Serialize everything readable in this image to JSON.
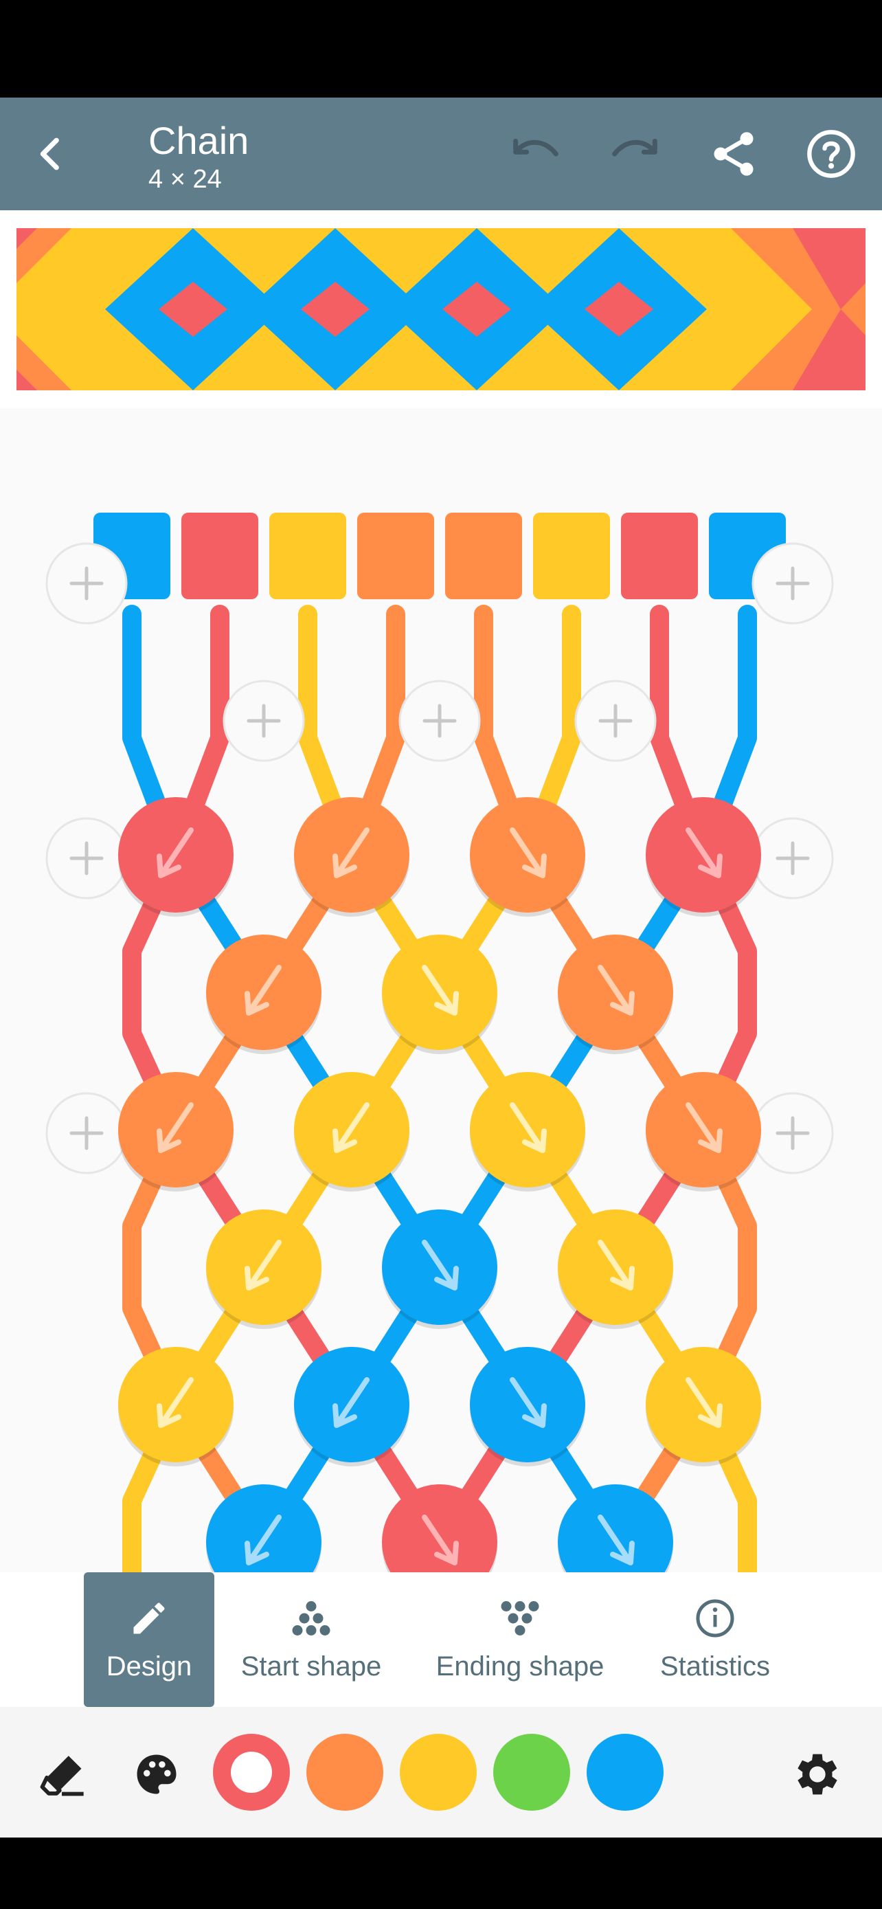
{
  "appbar": {
    "title": "Chain",
    "subtitle": "4 × 24",
    "back_icon": "arrow-back-icon",
    "undo_icon": "undo-icon",
    "redo_icon": "redo-icon",
    "share_icon": "share-icon",
    "help_icon": "help-icon"
  },
  "colors": {
    "red": "#f45f63",
    "orange": "#ff8d47",
    "yellow": "#ffc928",
    "green": "#6cd24a",
    "blue": "#0aa5f5",
    "appbar": "#607d8b"
  },
  "threads": [
    "blue",
    "red",
    "yellow",
    "orange",
    "orange",
    "yellow",
    "red",
    "blue"
  ],
  "knots": [
    [
      {
        "c": "red",
        "d": "left"
      },
      {
        "c": "orange",
        "d": "left"
      },
      {
        "c": "orange",
        "d": "right"
      },
      {
        "c": "red",
        "d": "right"
      }
    ],
    [
      {
        "c": "orange",
        "d": "left"
      },
      {
        "c": "yellow",
        "d": "right"
      },
      {
        "c": "orange",
        "d": "right"
      }
    ],
    [
      {
        "c": "orange",
        "d": "left"
      },
      {
        "c": "yellow",
        "d": "left"
      },
      {
        "c": "yellow",
        "d": "right"
      },
      {
        "c": "orange",
        "d": "right"
      }
    ],
    [
      {
        "c": "yellow",
        "d": "left"
      },
      {
        "c": "blue",
        "d": "right"
      },
      {
        "c": "yellow",
        "d": "right"
      }
    ],
    [
      {
        "c": "yellow",
        "d": "left"
      },
      {
        "c": "blue",
        "d": "left"
      },
      {
        "c": "blue",
        "d": "right"
      },
      {
        "c": "yellow",
        "d": "right"
      }
    ],
    [
      {
        "c": "blue",
        "d": "left"
      },
      {
        "c": "red",
        "d": "right"
      },
      {
        "c": "blue",
        "d": "right"
      }
    ]
  ],
  "tabs": [
    {
      "label": "Design",
      "icon": "pencil-icon",
      "active": true
    },
    {
      "label": "Start shape",
      "icon": "start-shape-icon",
      "active": false
    },
    {
      "label": "Ending shape",
      "icon": "ending-shape-icon",
      "active": false
    },
    {
      "label": "Statistics",
      "icon": "info-icon",
      "active": false
    }
  ],
  "toolbar": {
    "eraser_icon": "eraser-icon",
    "palette_icon": "palette-icon",
    "settings_icon": "gear-icon",
    "swatches": [
      "red",
      "orange",
      "yellow",
      "green",
      "blue"
    ],
    "selected_swatch": "red"
  }
}
